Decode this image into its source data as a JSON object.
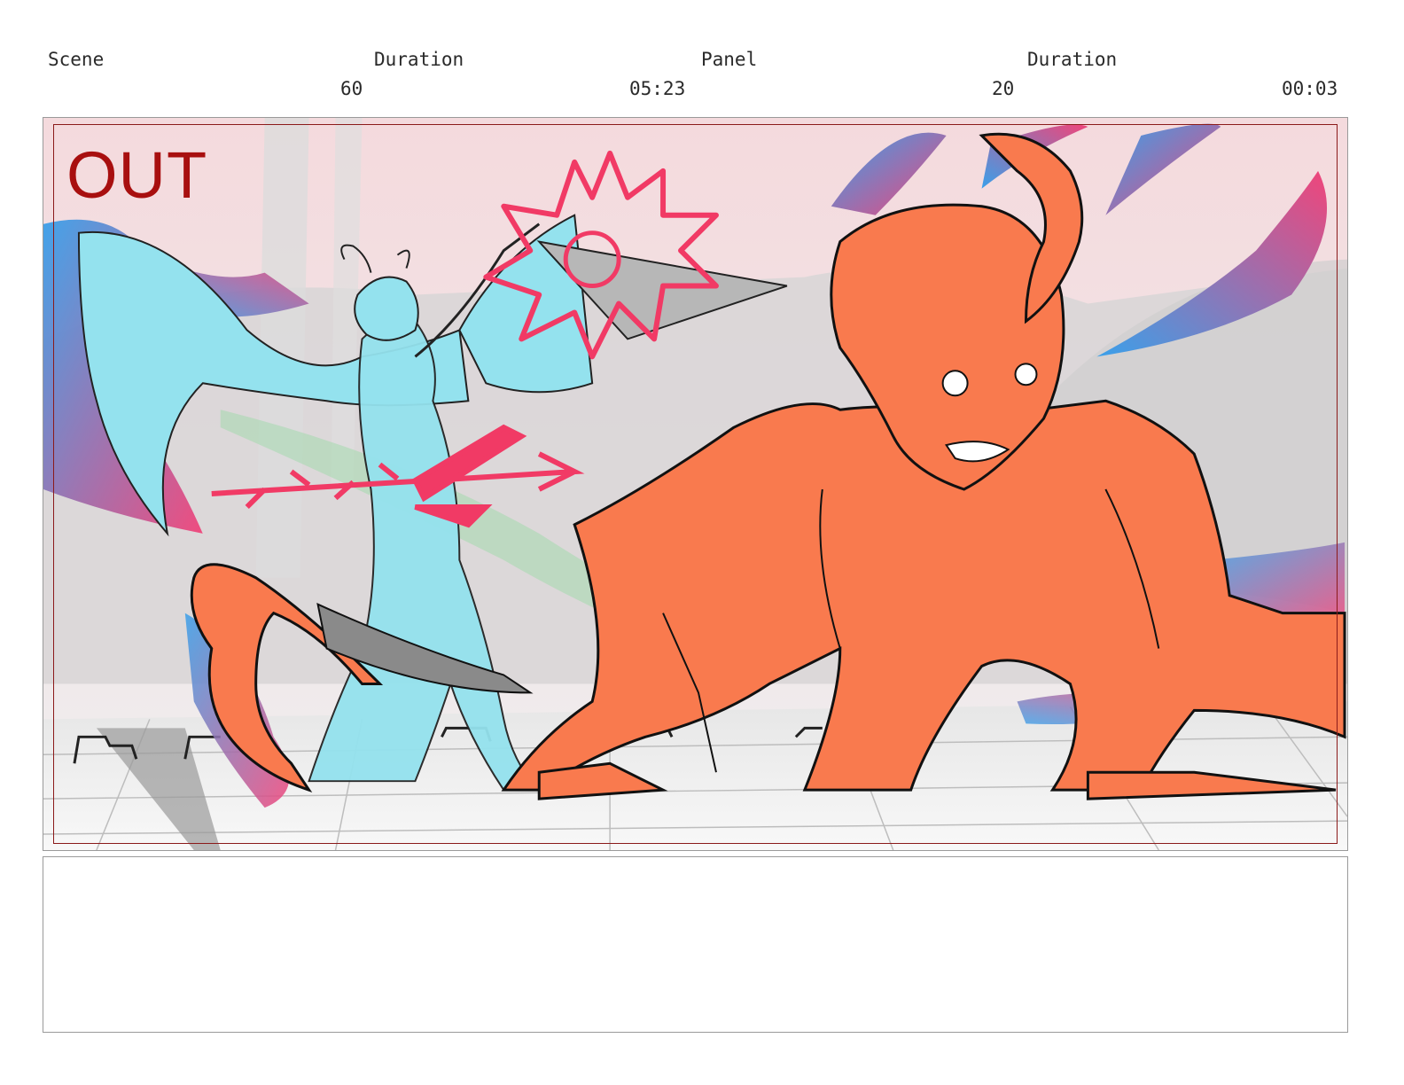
{
  "header": {
    "scene_label": "Scene",
    "scene_value": "60",
    "scene_duration_label": "Duration",
    "scene_duration_value": "05:23",
    "panel_label": "Panel",
    "panel_value": "20",
    "panel_duration_label": "Duration",
    "panel_duration_value": "00:03"
  },
  "panel": {
    "transition_label": "OUT",
    "colors": {
      "sky": "#f3dde0",
      "character_orange": "#f97a4e",
      "character_cyan": "#93e2ef",
      "effect_pink": "#f13a65",
      "streak_blue": "#3aa0ea",
      "safe_frame": "#8b1a1a"
    }
  },
  "notes": {
    "text": ""
  }
}
